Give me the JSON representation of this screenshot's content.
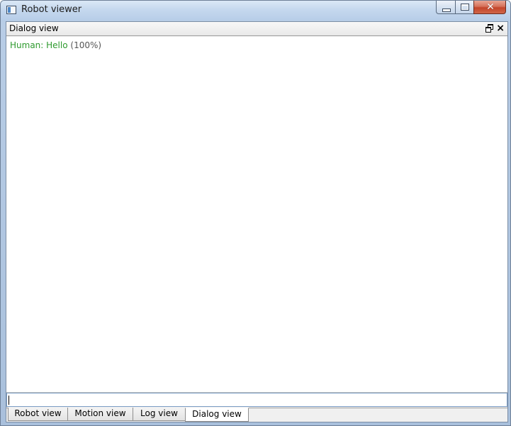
{
  "window": {
    "title": "Robot viewer",
    "close_glyph": "✕"
  },
  "dock": {
    "title": "Dialog view",
    "close_glyph": "×"
  },
  "dialog": {
    "messages": [
      {
        "text": "Human: Hello",
        "confidence": "(100%)"
      }
    ],
    "input_value": ""
  },
  "tabs": [
    {
      "label": "Robot view",
      "active": false
    },
    {
      "label": "Motion view",
      "active": false
    },
    {
      "label": "Log view",
      "active": false
    },
    {
      "label": "Dialog view",
      "active": true
    }
  ],
  "colors": {
    "message_text": "#2e9a2e",
    "title_bar": "#c5d8ee",
    "close_button": "#c3442a"
  },
  "icons": {
    "app": "app-window-icon",
    "minimize": "minimize-icon",
    "maximize": "maximize-icon",
    "close": "close-icon",
    "dock_float": "float-restore-icon",
    "dock_close": "close-icon"
  }
}
